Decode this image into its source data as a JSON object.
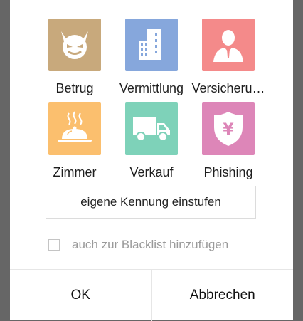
{
  "categories": [
    {
      "label": "Betrug",
      "icon": "devil-face-icon",
      "color": "#c8a97c"
    },
    {
      "label": "Vermittlung",
      "icon": "office-building-icon",
      "color": "#86a7dc"
    },
    {
      "label": "Versicheru…",
      "icon": "person-in-suit-icon",
      "color": "#f48a8a"
    },
    {
      "label": "Zimmer",
      "icon": "room-service-cloche-icon",
      "color": "#fbbf6e"
    },
    {
      "label": "Verkauf",
      "icon": "delivery-truck-icon",
      "color": "#7ed2b9"
    },
    {
      "label": "Phishing",
      "icon": "yen-shield-icon",
      "color": "#dd86b8"
    }
  ],
  "own_label_button": "eigene Kennung einstufen",
  "blacklist": {
    "label": "auch zur Blacklist hinzufügen",
    "checked": false
  },
  "footer": {
    "ok": "OK",
    "cancel": "Abbrechen"
  }
}
